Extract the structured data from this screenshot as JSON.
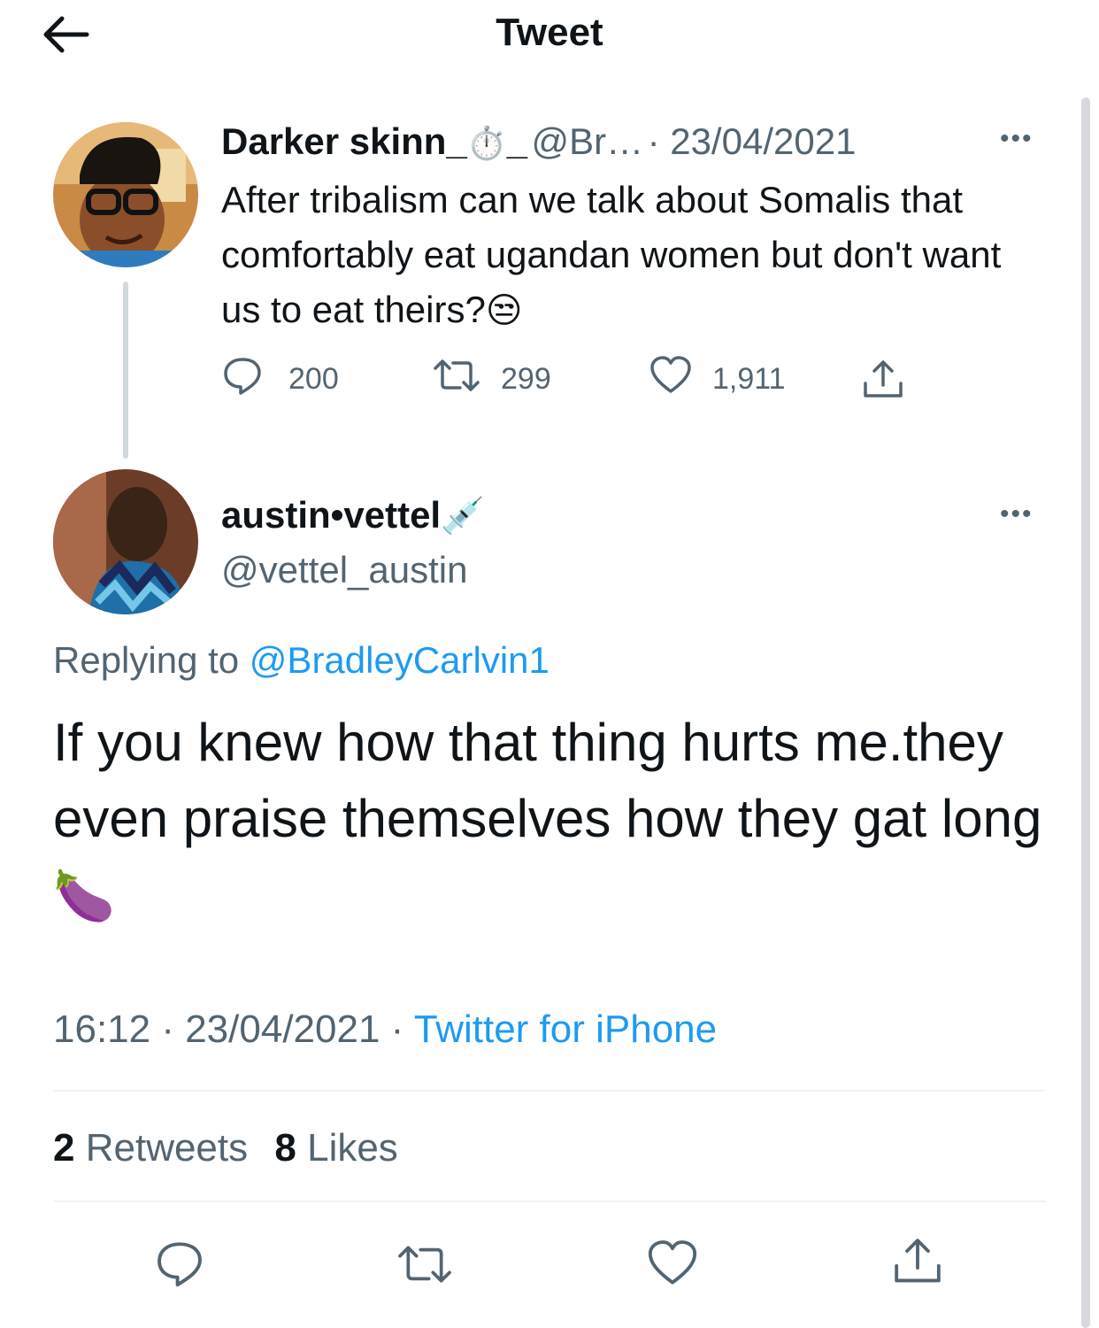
{
  "header": {
    "title": "Tweet"
  },
  "parent": {
    "display_name": "Darker skinn_",
    "name_suffix": "_",
    "handle": "@Br…",
    "date": "· 23/04/2021",
    "text": "After tribalism can we talk about Somalis that comfortably eat ugandan women but don't want us to eat theirs?",
    "emoji": "😒",
    "stopwatch_emoji": "⏱️",
    "replies": "200",
    "retweets": "299",
    "likes": "1,911"
  },
  "reply": {
    "display_name": "austin•vettel",
    "name_emoji": "💉",
    "handle": "@vettel_austin",
    "replying_prefix": "Replying to",
    "replying_to": "@BradleyCarlvin1",
    "text": "If you knew how that thing hurts me.they even praise themselves how they gat long",
    "emoji": "🍆",
    "time": "16:12 · 23/04/2021 ·",
    "source": "Twitter for iPhone",
    "retweets_count": "2",
    "retweets_label": "Retweets",
    "likes_count": "8",
    "likes_label": "Likes"
  },
  "colors": {
    "accent": "#1d9bf0",
    "secondary_text": "#536471",
    "text": "#0f1419"
  },
  "icons": [
    "back-arrow-icon",
    "more-icon",
    "reply-icon",
    "retweet-icon",
    "like-icon",
    "share-icon"
  ]
}
